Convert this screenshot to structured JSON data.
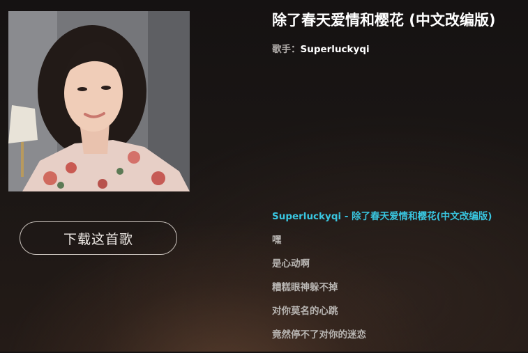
{
  "song": {
    "title": "除了春天爱情和樱花 (中文改编版)",
    "singer_label": "歌手：",
    "singer_name": "Superluckyqi"
  },
  "actions": {
    "download_label": "下载这首歌"
  },
  "lyrics": {
    "lines": [
      "Superluckyqi - 除了春天爱情和樱花(中文改编版)",
      "嘿",
      "是心动啊",
      "糟糕眼神躲不掉",
      "对你莫名的心跳",
      "竟然停不了对你的迷恋"
    ]
  },
  "colors": {
    "active_lyric": "#39c6e0",
    "lyric": "#b8b5b2",
    "background": "#1c1715"
  }
}
